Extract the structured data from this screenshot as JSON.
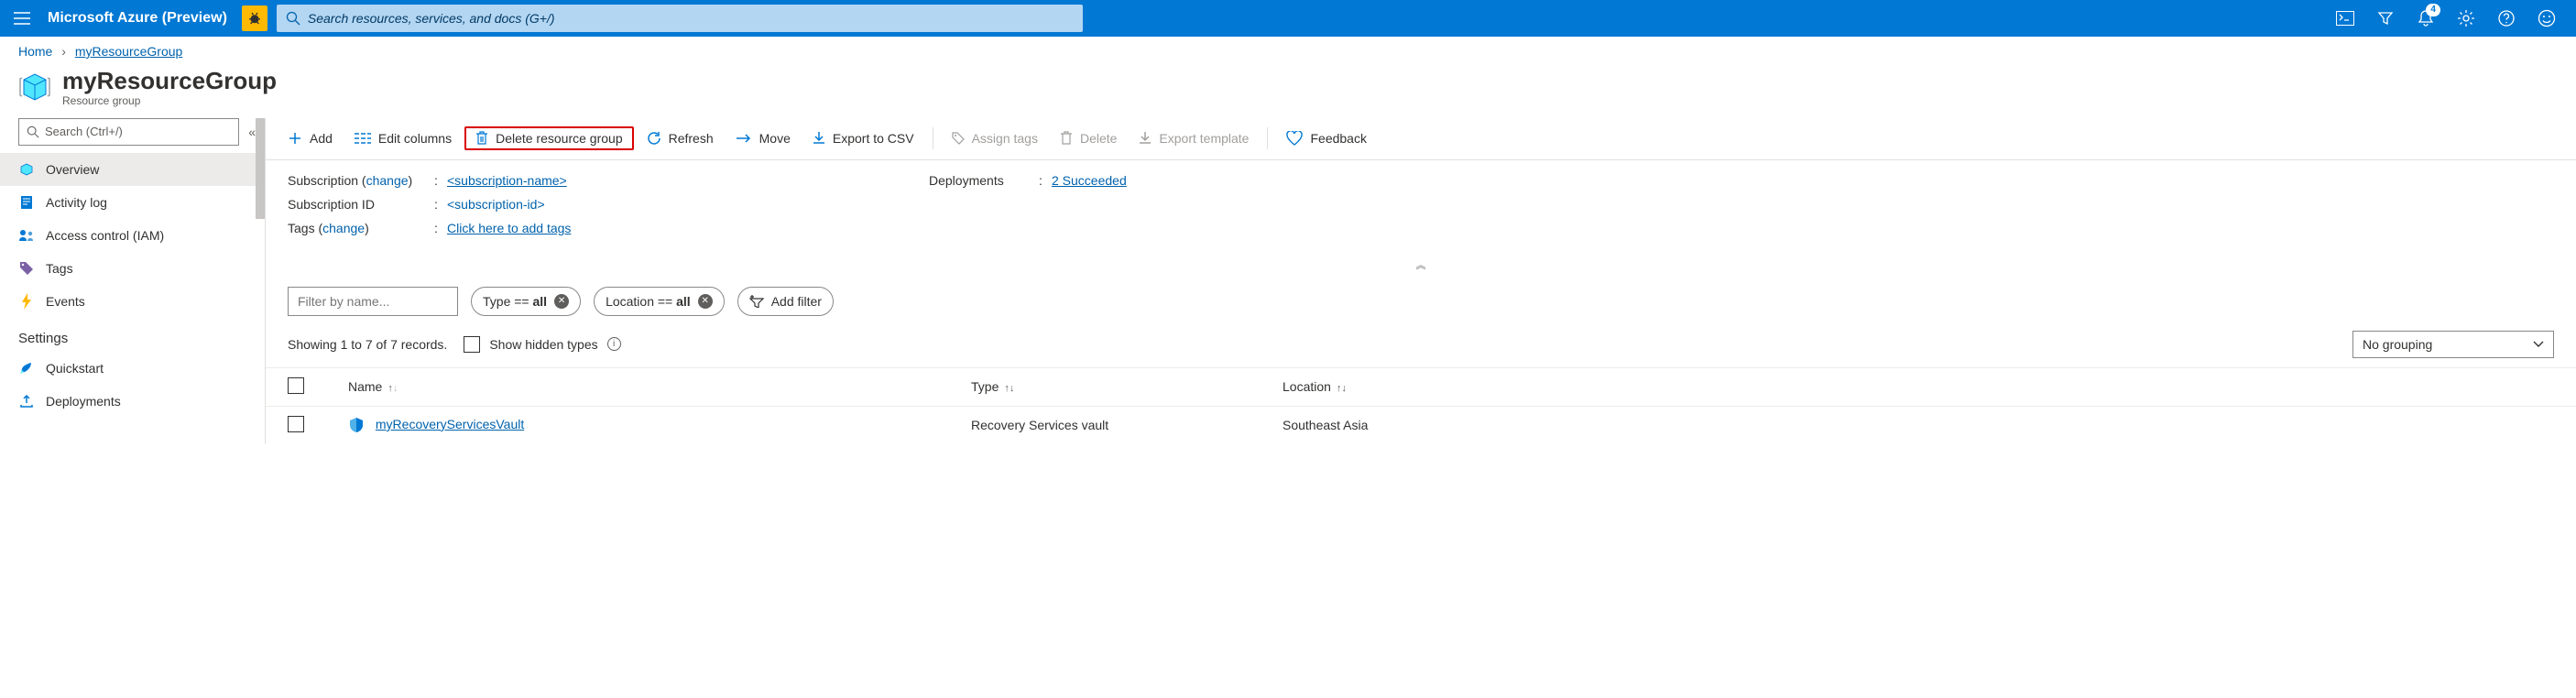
{
  "topbar": {
    "brand": "Microsoft Azure (Preview)",
    "search_placeholder": "Search resources, services, and docs (G+/)",
    "notification_count": "4"
  },
  "breadcrumb": {
    "home": "Home",
    "current": "myResourceGroup"
  },
  "title": {
    "name": "myResourceGroup",
    "subtitle": "Resource group"
  },
  "sidebar_search_placeholder": "Search (Ctrl+/)",
  "nav": {
    "overview": "Overview",
    "activity": "Activity log",
    "iam": "Access control (IAM)",
    "tags": "Tags",
    "events": "Events",
    "settings_head": "Settings",
    "quickstart": "Quickstart",
    "deployments": "Deployments"
  },
  "toolbar": {
    "add": "Add",
    "edit_columns": "Edit columns",
    "delete_rg": "Delete resource group",
    "refresh": "Refresh",
    "move": "Move",
    "export_csv": "Export to CSV",
    "assign_tags": "Assign tags",
    "delete": "Delete",
    "export_template": "Export template",
    "feedback": "Feedback"
  },
  "essentials": {
    "subscription_label": "Subscription",
    "change": "change",
    "subscription_name": "<subscription-name>",
    "subscription_id_label": "Subscription ID",
    "subscription_id": "<subscription-id>",
    "tags_label": "Tags",
    "tags_value": "Click here to add tags",
    "deployments_label": "Deployments",
    "deployments_value": "2 Succeeded"
  },
  "filters": {
    "name_placeholder": "Filter by name...",
    "type_prefix": "Type == ",
    "type_value": "all",
    "location_prefix": "Location == ",
    "location_value": "all",
    "add_filter": "Add filter"
  },
  "records": {
    "showing": "Showing 1 to 7 of 7 records.",
    "hidden_types": "Show hidden types",
    "grouping": "No grouping"
  },
  "table": {
    "col_name": "Name",
    "col_type": "Type",
    "col_location": "Location",
    "row1": {
      "name": "myRecoveryServicesVault",
      "type": "Recovery Services vault",
      "location": "Southeast Asia"
    }
  }
}
